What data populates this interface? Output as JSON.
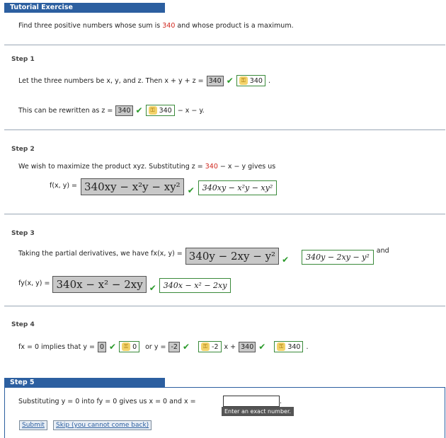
{
  "header": {
    "title": "Tutorial Exercise"
  },
  "problem": {
    "pre": "Find three positive numbers whose sum is ",
    "value": "340",
    "post": " and whose product is a maximum."
  },
  "step1": {
    "label": "Step 1",
    "line1_pre": "Let the three numbers be x, y, and z. Then  x + y + z  =",
    "ans1": "340",
    "key1": "340",
    "line2_pre": "This can be rewritten as z =",
    "ans2": "340",
    "key2": "340",
    "line2_post": "− x − y."
  },
  "step2": {
    "label": "Step 2",
    "text_pre": "We wish to maximize the product xyz. Substituting z = ",
    "text_val": "340",
    "text_post": " − x − y gives us",
    "f_label": "f(x, y) =",
    "ans": "340xy − x²y − xy²",
    "key": "340xy − x²y − xy²"
  },
  "step3": {
    "label": "Step 3",
    "text_pre": "Taking the partial derivatives, we have  fx(x, y) =",
    "ans1": "340y − 2xy − y²",
    "key1": "340y − 2xy − y²",
    "and": "and",
    "fy_label": "fy(x, y) =",
    "ans2": "340x − x² − 2xy",
    "key2": "340x − x² − 2xy"
  },
  "step4": {
    "label": "Step 4",
    "text_pre": "fx = 0  implies that y =",
    "ans1": "0",
    "key1": "0",
    "or": "or  y =",
    "ans2": "-2",
    "key2": "-2",
    "x_plus": "x +",
    "ans3": "340",
    "key3": "340"
  },
  "step5": {
    "label": "Step 5",
    "text": "Substituting y = 0 into  fy = 0  gives us x = 0 and x =",
    "tooltip": "Enter an exact number.",
    "submit": "Submit",
    "skip": "Skip (you cannot come back)"
  },
  "icons": {
    "check": "✔",
    "key": "🔑"
  }
}
